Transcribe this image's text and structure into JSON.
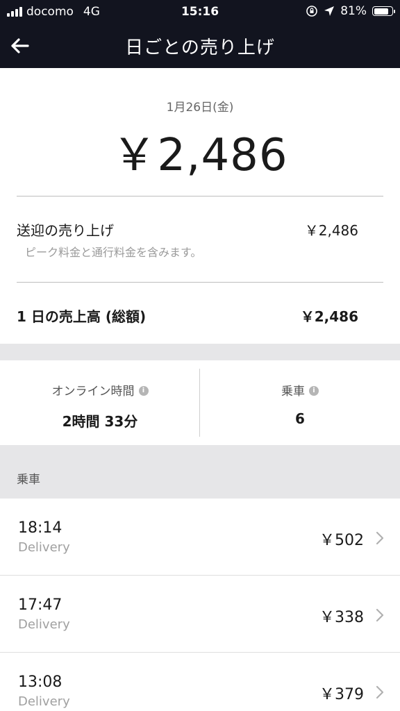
{
  "status_bar": {
    "carrier": "docomo",
    "network": "4G",
    "time": "15:16",
    "battery_text": "81%",
    "battery_level": 0.81
  },
  "header": {
    "title": "日ごとの売り上げ",
    "back_icon": "arrow-left-icon"
  },
  "summary": {
    "date": "1月26日(金)",
    "total": "￥2,486",
    "pickup_label": "送迎の売り上げ",
    "pickup_value": "￥2,486",
    "pickup_note": "ピーク料金と通行料金を含みます。",
    "daily_gross_label": "1 日の売上高 (総額)",
    "daily_gross_value": "￥2,486"
  },
  "stats": {
    "online_label": "オンライン時間",
    "online_value": "2時間 33分",
    "rides_label": "乗車",
    "rides_value": "6",
    "info_icon": "info-icon"
  },
  "trips_section": {
    "title": "乗車",
    "items": [
      {
        "time": "18:14",
        "type": "Delivery",
        "fare": "￥502"
      },
      {
        "time": "17:47",
        "type": "Delivery",
        "fare": "￥338"
      },
      {
        "time": "13:08",
        "type": "Delivery",
        "fare": "￥379"
      }
    ]
  },
  "colors": {
    "header_bg": "#12141f",
    "band_gray": "#e6e6e8",
    "muted_text": "#9a9a9a"
  }
}
